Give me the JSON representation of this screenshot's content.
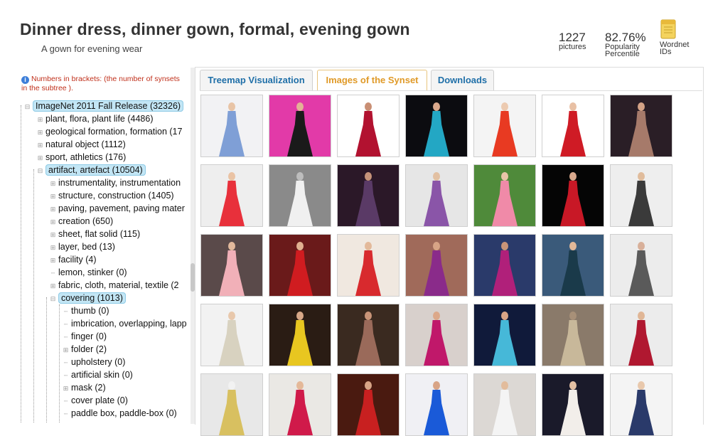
{
  "header": {
    "title": "Dinner dress, dinner gown, formal, evening gown",
    "subtitle": "A gown for evening wear",
    "pictures_count": "1227",
    "pictures_label": "pictures",
    "popularity_value": "82.76%",
    "popularity_label_1": "Popularity",
    "popularity_label_2": "Percentile",
    "wordnet_label_1": "Wordnet",
    "wordnet_label_2": "IDs"
  },
  "note": "Numbers in brackets: (the number of synsets in the subtree ).",
  "tree": [
    {
      "label": "ImageNet 2011 Fall Release (32326)",
      "level": 0,
      "toggle": "-",
      "selected": true
    },
    {
      "label": "plant, flora, plant life (4486)",
      "level": 1,
      "toggle": "+",
      "selected": false
    },
    {
      "label": "geological formation, formation (17",
      "level": 1,
      "toggle": "+",
      "selected": false
    },
    {
      "label": "natural object (1112)",
      "level": 1,
      "toggle": "+",
      "selected": false
    },
    {
      "label": "sport, athletics (176)",
      "level": 1,
      "toggle": "+",
      "selected": false
    },
    {
      "label": "artifact, artefact (10504)",
      "level": 1,
      "toggle": "-",
      "selected": true
    },
    {
      "label": "instrumentality, instrumentation",
      "level": 2,
      "toggle": "+",
      "selected": false
    },
    {
      "label": "structure, construction (1405)",
      "level": 2,
      "toggle": "+",
      "selected": false
    },
    {
      "label": "paving, pavement, paving mater",
      "level": 2,
      "toggle": "+",
      "selected": false
    },
    {
      "label": "creation (650)",
      "level": 2,
      "toggle": "+",
      "selected": false
    },
    {
      "label": "sheet, flat solid (115)",
      "level": 2,
      "toggle": "+",
      "selected": false
    },
    {
      "label": "layer, bed (13)",
      "level": 2,
      "toggle": "+",
      "selected": false
    },
    {
      "label": "facility (4)",
      "level": 2,
      "toggle": "+",
      "selected": false
    },
    {
      "label": "lemon, stinker (0)",
      "level": 2,
      "toggle": "",
      "selected": false
    },
    {
      "label": "fabric, cloth, material, textile (2",
      "level": 2,
      "toggle": "+",
      "selected": false
    },
    {
      "label": "covering (1013)",
      "level": 2,
      "toggle": "-",
      "selected": true
    },
    {
      "label": "thumb (0)",
      "level": 3,
      "toggle": "",
      "selected": false
    },
    {
      "label": "imbrication, overlapping, lapp",
      "level": 3,
      "toggle": "",
      "selected": false
    },
    {
      "label": "finger (0)",
      "level": 3,
      "toggle": "",
      "selected": false
    },
    {
      "label": "folder (2)",
      "level": 3,
      "toggle": "+",
      "selected": false
    },
    {
      "label": "upholstery (0)",
      "level": 3,
      "toggle": "",
      "selected": false
    },
    {
      "label": "artificial skin (0)",
      "level": 3,
      "toggle": "",
      "selected": false
    },
    {
      "label": "mask (2)",
      "level": 3,
      "toggle": "+",
      "selected": false
    },
    {
      "label": "cover plate (0)",
      "level": 3,
      "toggle": "",
      "selected": false
    },
    {
      "label": "paddle box, paddle-box (0)",
      "level": 3,
      "toggle": "",
      "selected": false
    }
  ],
  "tabs": [
    {
      "label": "Treemap Visualization",
      "active": false
    },
    {
      "label": "Images of the Synset",
      "active": true
    },
    {
      "label": "Downloads",
      "active": false
    }
  ],
  "images": [
    {
      "bg": "#f2f2f4",
      "dress": "#7f9fd6",
      "skin": "#e8c4a6"
    },
    {
      "bg": "#e23aa8",
      "dress": "#1a1a1a",
      "skin": "#e3b296"
    },
    {
      "bg": "#ffffff",
      "dress": "#b21230",
      "skin": "#c98f74"
    },
    {
      "bg": "#0c0c10",
      "dress": "#23a7c4",
      "skin": "#d9a88c"
    },
    {
      "bg": "#f4f4f4",
      "dress": "#e83a22",
      "skin": "#eccab0"
    },
    {
      "bg": "#ffffff",
      "dress": "#cf1b25",
      "skin": "#e8c0a4"
    },
    {
      "bg": "#2a1e26",
      "dress": "#a67a6a",
      "skin": "#d3a286"
    },
    {
      "bg": "#eeeeee",
      "dress": "#e8303b",
      "skin": "#eac3a4"
    },
    {
      "bg": "#8a8a8a",
      "dress": "#f0f0f0",
      "skin": "#bdbdbd"
    },
    {
      "bg": "#2b1828",
      "dress": "#5a3a66",
      "skin": "#c5937a"
    },
    {
      "bg": "#e6e6e6",
      "dress": "#8a55a8",
      "skin": "#e2c0a2"
    },
    {
      "bg": "#4f8a3a",
      "dress": "#f08aa8",
      "skin": "#e8c4a8"
    },
    {
      "bg": "#050505",
      "dress": "#c81826",
      "skin": "#d8a88c"
    },
    {
      "bg": "#eeeeee",
      "dress": "#3a3a3a",
      "skin": "#e0bc9c"
    },
    {
      "bg": "#5a4a4a",
      "dress": "#f1b0b8",
      "skin": "#e2b99c"
    },
    {
      "bg": "#6a1a1a",
      "dress": "#d01c20",
      "skin": "#e0b090"
    },
    {
      "bg": "#f0e8e0",
      "dress": "#d82a2e",
      "skin": "#e3b99a"
    },
    {
      "bg": "#a06a5a",
      "dress": "#8a2b8a",
      "skin": "#d8a486"
    },
    {
      "bg": "#2a3a6a",
      "dress": "#b0207a",
      "skin": "#c89478"
    },
    {
      "bg": "#3a5a7a",
      "dress": "#1a3a4a",
      "skin": "#e2b898"
    },
    {
      "bg": "#ececec",
      "dress": "#5a5a5a",
      "skin": "#d8b09a"
    },
    {
      "bg": "#f2f2f2",
      "dress": "#d8d2c0",
      "skin": "#e8c8ac"
    },
    {
      "bg": "#2a1c14",
      "dress": "#e8c620",
      "skin": "#d8a888"
    },
    {
      "bg": "#3a2a20",
      "dress": "#9a6a5a",
      "skin": "#c89478"
    },
    {
      "bg": "#d8d0cc",
      "dress": "#c0186a",
      "skin": "#dca88a"
    },
    {
      "bg": "#101a3a",
      "dress": "#46b8d8",
      "skin": "#d8a486"
    },
    {
      "bg": "#8a7a6a",
      "dress": "#c8b89a",
      "skin": "#a89078"
    },
    {
      "bg": "#ececec",
      "dress": "#b01830",
      "skin": "#e0b696"
    },
    {
      "bg": "#e8e8e8",
      "dress": "#d8c060",
      "skin": "#f2f2f2"
    },
    {
      "bg": "#eae8e4",
      "dress": "#d01a4a",
      "skin": "#e4b898"
    },
    {
      "bg": "#4a1a10",
      "dress": "#c82020",
      "skin": "#d8a486"
    },
    {
      "bg": "#f0f0f4",
      "dress": "#1a5ad8",
      "skin": "#d8a486"
    },
    {
      "bg": "#dcd8d4",
      "dress": "#f4f4f4",
      "skin": "#e2bc9c"
    },
    {
      "bg": "#1a1a2a",
      "dress": "#f2eeea",
      "skin": "#e4c0a4"
    },
    {
      "bg": "#f4f4f4",
      "dress": "#2a3a6a",
      "skin": "#e8c8ac"
    }
  ]
}
